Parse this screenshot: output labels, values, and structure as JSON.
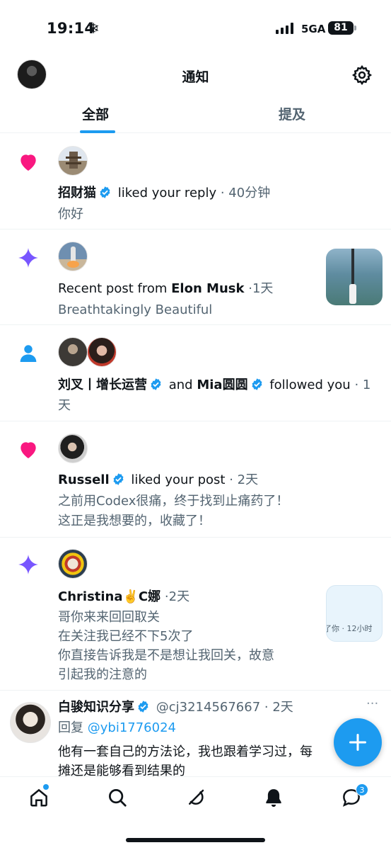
{
  "status_bar": {
    "time": "19:14",
    "indicator_icon": "snowflake-icon",
    "network": "5GA",
    "battery": "81"
  },
  "header": {
    "title": "通知",
    "tabs": [
      {
        "label": "全部",
        "active": true
      },
      {
        "label": "提及",
        "active": false
      }
    ]
  },
  "colors": {
    "accent": "#1d9bf0",
    "like": "#f91880",
    "sparkle": "#7856ff",
    "text": "#0f1419",
    "muted": "#536471"
  },
  "notifications": [
    {
      "type": "like",
      "icon": "heart-icon",
      "name": "招财猫",
      "action": "liked your reply",
      "sep": "·",
      "time": "40分钟",
      "text": "你好"
    },
    {
      "type": "recent_post",
      "icon": "sparkle-icon",
      "prefix": "Recent post from ",
      "name": "Elon Musk",
      "sep": "·",
      "time": "1天",
      "text": "Breathtakingly Beautiful"
    },
    {
      "type": "follow",
      "icon": "person-icon",
      "name1": "刘叉丨增长运营",
      "and": "and",
      "name2": "Mia圆圆",
      "action": "followed you",
      "sep": "·",
      "time_part1": "1",
      "time_part2": "天"
    },
    {
      "type": "like",
      "icon": "heart-icon",
      "name": "Russell",
      "action": "liked your post",
      "sep": "·",
      "time": "2天",
      "text_line1": "之前用Codex很痛，终于找到止痛药了！",
      "text_line2": "这正是我想要的，收藏了！"
    },
    {
      "type": "recent_post",
      "icon": "sparkle-icon",
      "name": "Christina✌️C娜",
      "sep": "·",
      "time": "2天",
      "text_line1": "哥你来来回回取关",
      "text_line2": "在关注我已经不下5次了",
      "text_line3": "你直接告诉我是不是想让我回关，故意",
      "text_line4": "引起我的注意的",
      "quote_snippet": "了你 · 12小时"
    },
    {
      "type": "reply",
      "name": "白骏知识分享",
      "handle": "@cj3214567667",
      "sep": "·",
      "time": "2天",
      "reply_prefix": "回复",
      "reply_to": "@ybi1776024",
      "text_line1": "他有一套自己的方法论，我也跟着学习过，每",
      "text_line2": "摊还是能够看到结果的",
      "more": "···"
    }
  ],
  "bottom_nav": {
    "items": [
      {
        "icon": "home-icon",
        "has_dot": true
      },
      {
        "icon": "search-icon"
      },
      {
        "icon": "grok-icon"
      },
      {
        "icon": "bell-icon",
        "active": true
      },
      {
        "icon": "messages-icon",
        "badge": "3"
      }
    ]
  }
}
